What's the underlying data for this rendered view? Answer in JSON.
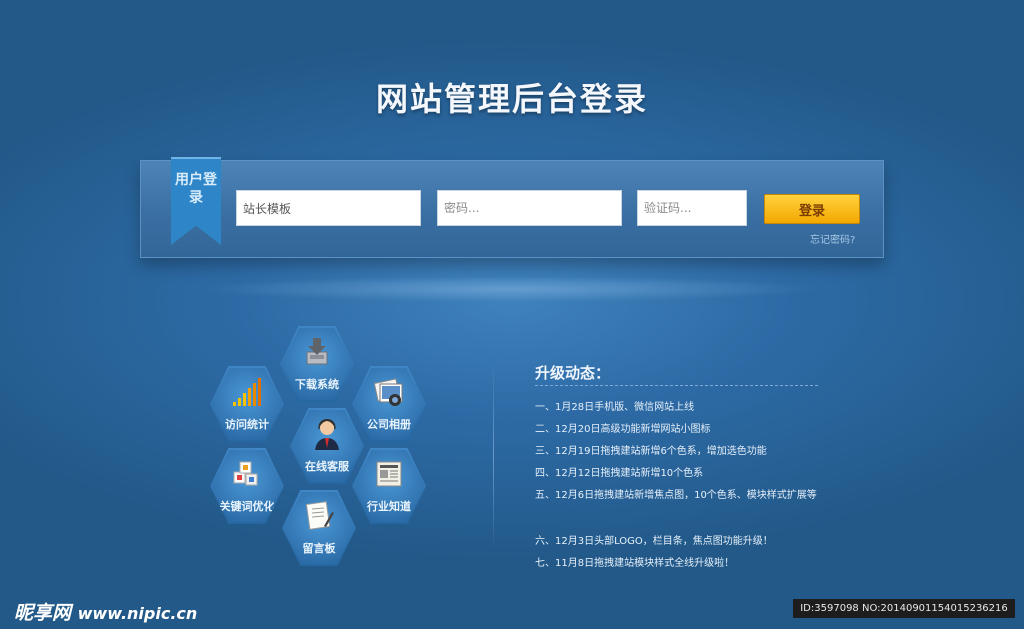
{
  "title": "网站管理后台登录",
  "login": {
    "ribbon_label": "用户登录",
    "username_value": "站长模板",
    "password_placeholder": "密码...",
    "captcha_placeholder": "验证码...",
    "submit_label": "登录",
    "forgot_label": "忘记密码?"
  },
  "modules": [
    {
      "label": "下载系统",
      "icon": "download-icon"
    },
    {
      "label": "访问统计",
      "icon": "bar-chart-icon"
    },
    {
      "label": "公司相册",
      "icon": "photo-album-icon"
    },
    {
      "label": "在线客服",
      "icon": "customer-service-icon"
    },
    {
      "label": "关键词优化",
      "icon": "keyword-blocks-icon"
    },
    {
      "label": "行业知道",
      "icon": "newspaper-icon"
    },
    {
      "label": "留言板",
      "icon": "message-note-icon"
    }
  ],
  "news": {
    "title": "升级动态：",
    "items": [
      "一、1月28日手机版、微信网站上线",
      "二、12月20日高级功能新增网站小图标",
      "三、12月19日拖拽建站新增6个色系，增加选色功能",
      "四、12月12日拖拽建站新增10个色系",
      "五、12月6日拖拽建站新增焦点图，10个色系、模块样式扩展等",
      "六、12月3日头部LOGO，栏目条，焦点图功能升级！",
      "七、11月8日拖拽建站模块样式全线升级啦！"
    ]
  },
  "footer": {
    "logo_text": "昵享网",
    "site": "www.nipic.cn",
    "id_text": "ID:3597098 NO:20140901154015236216"
  }
}
